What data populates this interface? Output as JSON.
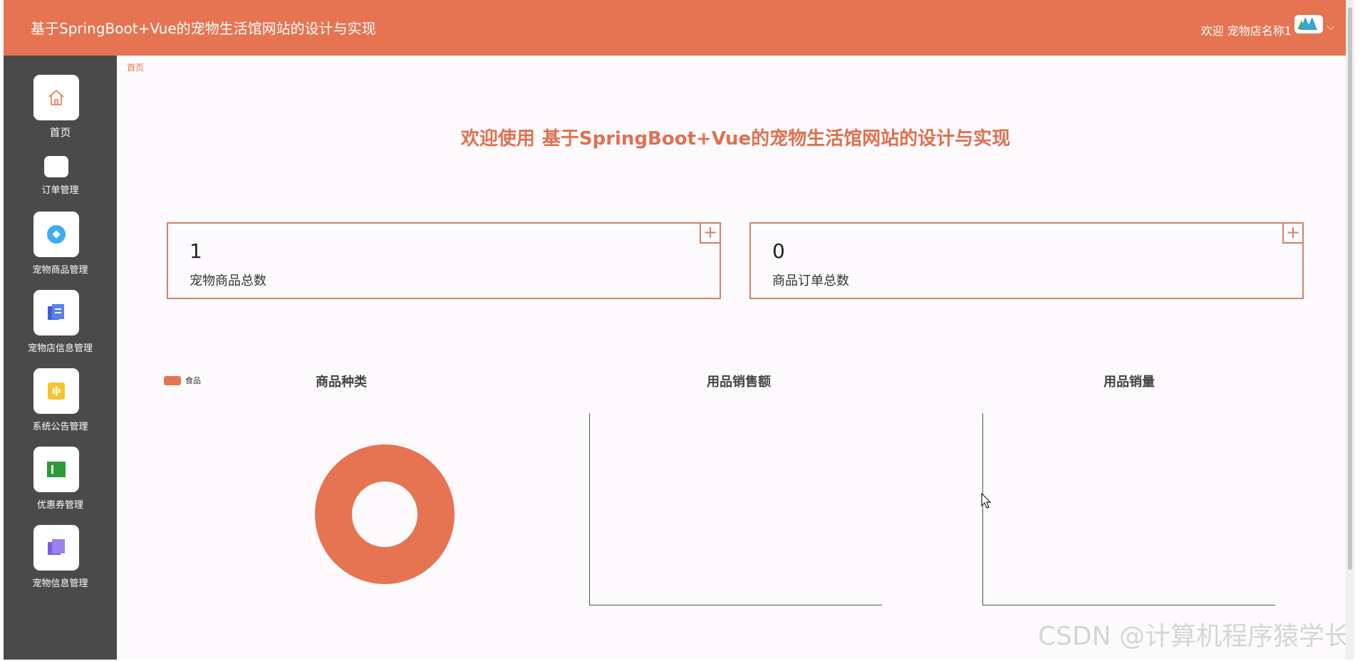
{
  "header": {
    "title": "基于SpringBoot+Vue的宠物生活馆网站的设计与实现",
    "welcome": "欢迎 宠物店名称1",
    "chevron": "⌵"
  },
  "sidebar": {
    "items": [
      {
        "label": "首页",
        "icon": "home-icon"
      },
      {
        "label": "订单管理",
        "icon": "blank-icon"
      },
      {
        "label": "宠物商品管理",
        "icon": "diamond-circle-icon"
      },
      {
        "label": "宠物店信息管理",
        "icon": "files-icon"
      },
      {
        "label": "系统公告管理",
        "icon": "bars-icon"
      },
      {
        "label": "优惠券管理",
        "icon": "coupon-icon"
      },
      {
        "label": "宠物信息管理",
        "icon": "folder-icon"
      }
    ]
  },
  "breadcrumb": "首页",
  "page_title": {
    "prefix": "欢迎使用",
    "name": "基于SpringBoot+Vue的宠物生活馆网站的设计与实现"
  },
  "stats": [
    {
      "value": "1",
      "label": "宠物商品总数",
      "plus": "+"
    },
    {
      "value": "0",
      "label": "商品订单总数",
      "plus": "+"
    }
  ],
  "colors": {
    "accent": "#e67452",
    "sidebar": "#4a4a4a",
    "title": "#e07050"
  },
  "chart_data": [
    {
      "type": "pie",
      "title": "商品种类",
      "donut": true,
      "categories": [
        "食品"
      ],
      "values": [
        1
      ],
      "legend": "top-left",
      "colors": [
        "#e67452"
      ]
    },
    {
      "type": "bar",
      "title": "用品销售额",
      "categories": [],
      "values": []
    },
    {
      "type": "bar",
      "title": "用品销量",
      "categories": [],
      "values": []
    }
  ],
  "watermark": "CSDN @计算机程序猿学长"
}
